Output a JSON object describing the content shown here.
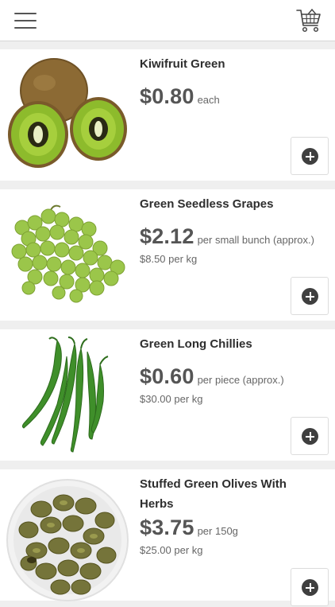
{
  "header": {
    "menu_icon": "hamburger-menu-icon",
    "cart_icon": "shopping-basket-icon"
  },
  "products": [
    {
      "name": "Kiwifruit Green",
      "price": "$0.80",
      "unit": "each",
      "per_kg": "",
      "image": "kiwifruit-image"
    },
    {
      "name": "Green Seedless Grapes",
      "price": "$2.12",
      "unit": "per small bunch (approx.)",
      "per_kg": "$8.50 per kg",
      "image": "grapes-image"
    },
    {
      "name": "Green Long Chillies",
      "price": "$0.60",
      "unit": "per piece (approx.)",
      "per_kg": "$30.00 per kg",
      "image": "chillies-image"
    },
    {
      "name": "Stuffed Green Olives With Herbs",
      "price": "$3.75",
      "unit": "per 150g",
      "per_kg": "$25.00 per kg",
      "image": "olives-image"
    }
  ],
  "colors": {
    "accent": "#3f3f3f",
    "separator": "#efefef"
  }
}
